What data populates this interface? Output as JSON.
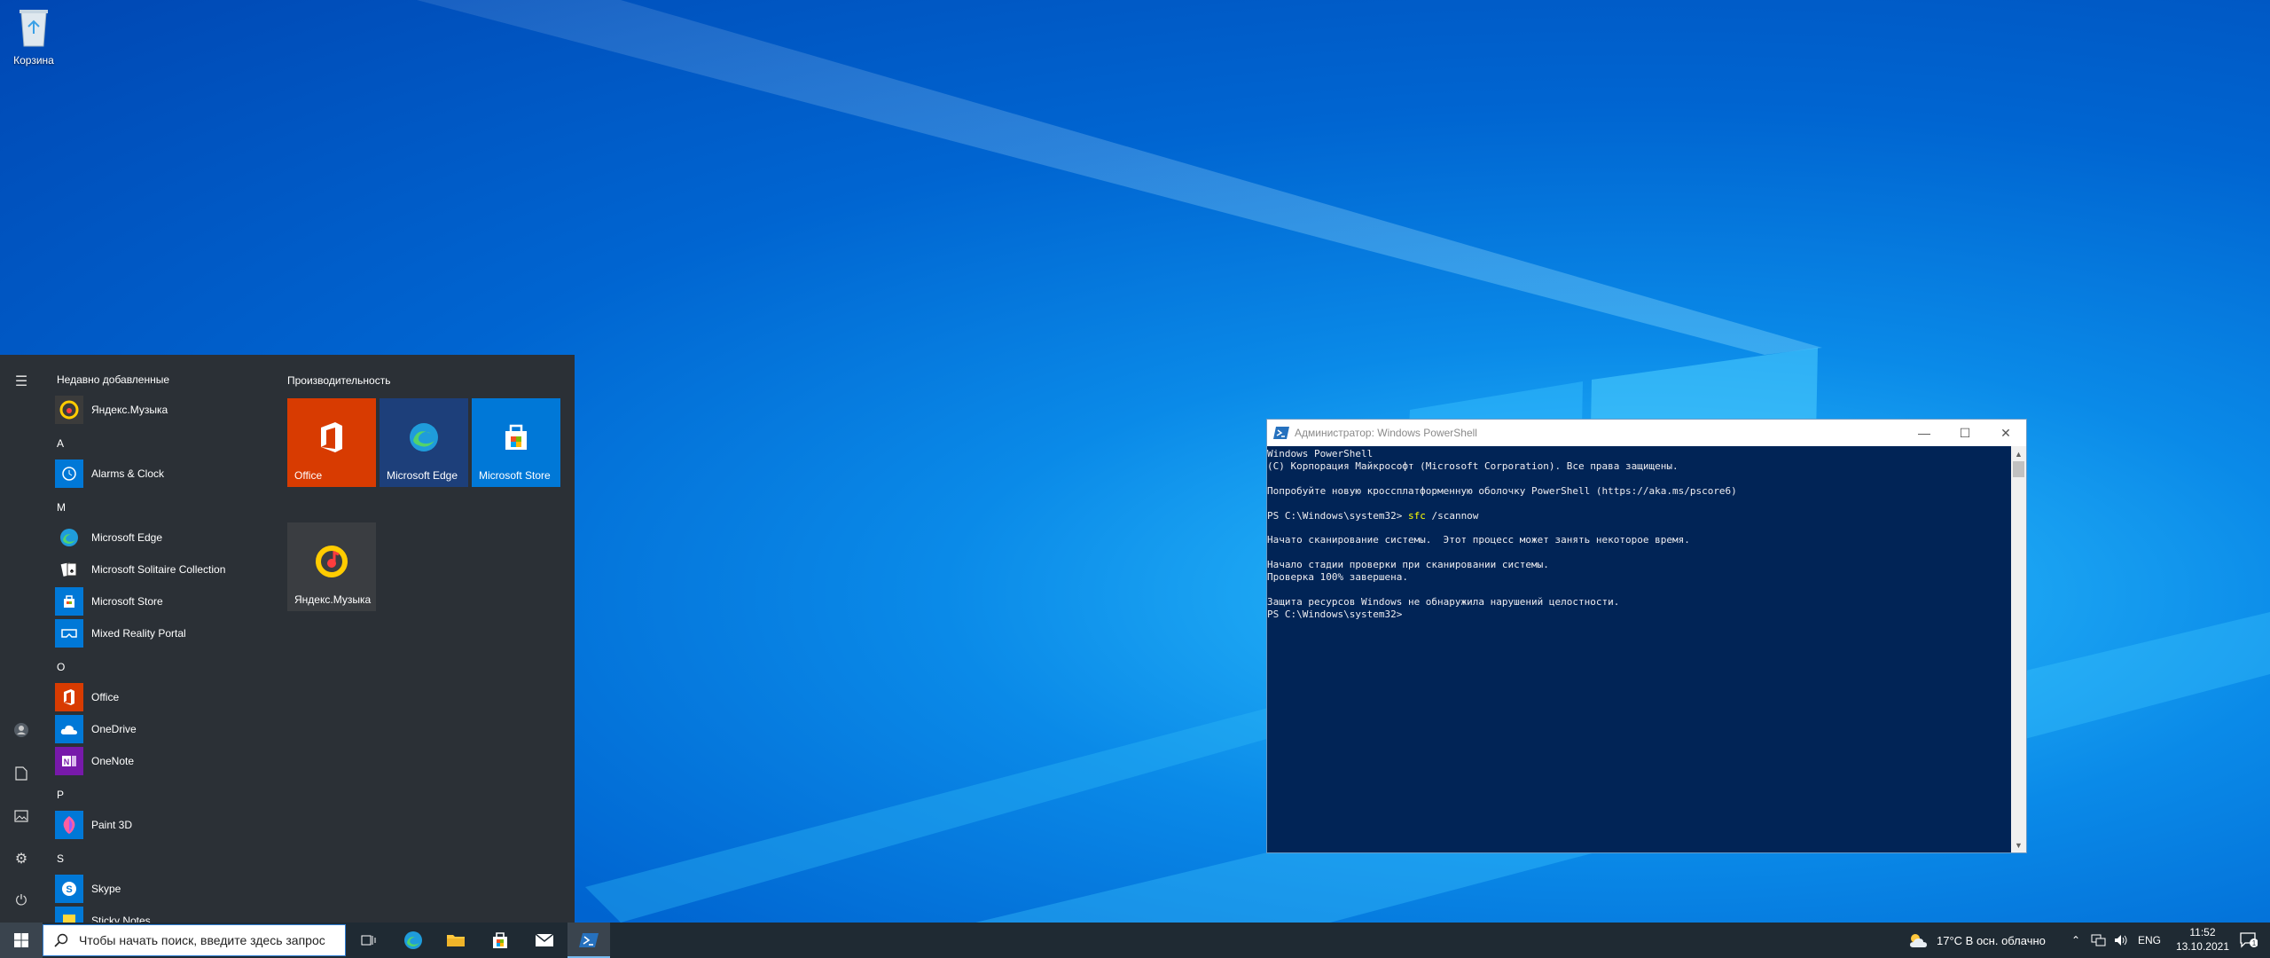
{
  "desktop": {
    "recycle_bin_label": "Корзина"
  },
  "start_menu": {
    "recently_added_title": "Недавно добавленные",
    "productivity_title": "Производительность",
    "recent_app": "Яндекс.Музыка",
    "letters": [
      "A",
      "M",
      "O",
      "P",
      "S"
    ],
    "apps": {
      "alarms": "Alarms & Clock",
      "edge": "Microsoft Edge",
      "solitaire": "Microsoft Solitaire Collection",
      "store": "Microsoft Store",
      "mixed_reality": "Mixed Reality Portal",
      "office": "Office",
      "onedrive": "OneDrive",
      "onenote": "OneNote",
      "paint3d": "Paint 3D",
      "skype": "Skype",
      "sticky": "Sticky Notes"
    },
    "tiles": {
      "office": "Office",
      "edge": "Microsoft Edge",
      "store": "Microsoft Store",
      "yandex": "Яндекс.Музыка"
    }
  },
  "powershell": {
    "title": "Администратор: Windows PowerShell",
    "lines": {
      "l1": "Windows PowerShell",
      "l2": "(C) Корпорация Майкрософт (Microsoft Corporation). Все права защищены.",
      "l3": "Попробуйте новую кроссплатформенную оболочку PowerShell (https://aka.ms/pscore6)",
      "prompt1": "PS C:\\Windows\\system32> ",
      "cmd": "sfc",
      "cmd_arg": " /scannow",
      "l5": "Начато сканирование системы.  Этот процесс может занять некоторое время.",
      "l6": "Начало стадии проверки при сканировании системы.",
      "l7": "Проверка 100% завершена.",
      "l8": "Защита ресурсов Windows не обнаружила нарушений целостности.",
      "prompt2": "PS C:\\Windows\\system32>"
    }
  },
  "taskbar": {
    "search_placeholder": "Чтобы начать поиск, введите здесь запрос",
    "weather": "17°C  В осн. облачно",
    "language": "ENG",
    "time": "11:52",
    "date": "13.10.2021",
    "notification_count": "1"
  }
}
